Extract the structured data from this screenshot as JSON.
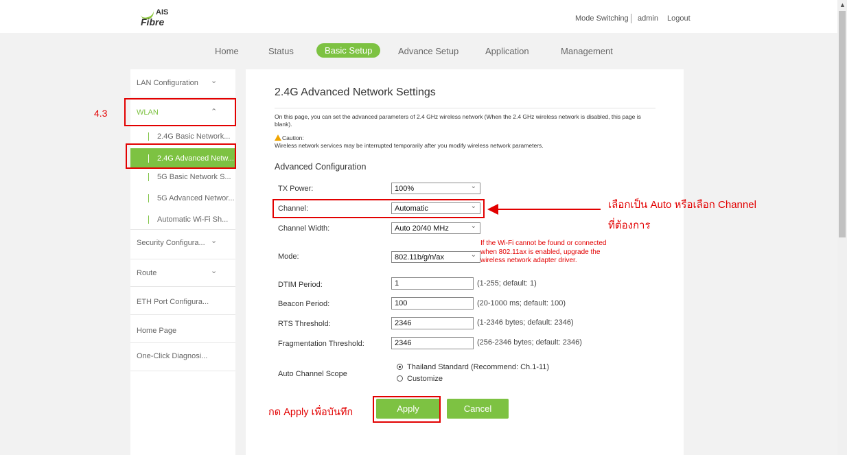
{
  "brand": {
    "logo_top": "AIS",
    "logo_bottom": "Fibre",
    "accent": "#7dc242",
    "annotation_color": "#e20000"
  },
  "header": {
    "mode_switching": "Mode Switching",
    "user": "admin",
    "logout": "Logout"
  },
  "nav": {
    "items": [
      "Home",
      "Status",
      "Basic Setup",
      "Advance Setup",
      "Application",
      "Management"
    ],
    "active": "Basic Setup"
  },
  "sidebar": {
    "items": [
      {
        "label": "LAN Configuration",
        "icon": "chevron-down-icon"
      },
      {
        "label": "WLAN",
        "icon": "chevron-up-icon"
      },
      {
        "label": "Security Configura...",
        "icon": "chevron-down-icon"
      },
      {
        "label": "Route",
        "icon": "chevron-down-icon"
      },
      {
        "label": "ETH Port Configura..."
      },
      {
        "label": "Home Page"
      },
      {
        "label": "One-Click Diagnosi..."
      }
    ],
    "wlan_sub": [
      "2.4G Basic Network...",
      "2.4G Advanced Netw...",
      "5G Basic Network S...",
      "5G Advanced Networ...",
      "Automatic Wi-Fi Sh..."
    ],
    "active_sub": "2.4G Advanced Netw..."
  },
  "page": {
    "title": "2.4G Advanced Network Settings",
    "description": "On this page, you can set the advanced parameters of 2.4 GHz wireless network (When the 2.4 GHz wireless network is disabled, this page is blank).",
    "caution_label": "Caution:",
    "caution_text": "Wireless network services may be interrupted temporarily after you modify wireless network parameters.",
    "section": "Advanced Configuration"
  },
  "form": {
    "tx_power": {
      "label": "TX Power:",
      "value": "100%"
    },
    "channel": {
      "label": "Channel:",
      "value": "Automatic"
    },
    "channel_width": {
      "label": "Channel Width:",
      "value": "Auto 20/40 MHz"
    },
    "mode": {
      "label": "Mode:",
      "value": "802.11b/g/n/ax",
      "note_lines": [
        "If the Wi-Fi cannot be found or connected",
        "when 802.11ax is enabled, upgrade the",
        "wireless network adapter driver."
      ]
    },
    "dtim": {
      "label": "DTIM Period:",
      "value": "1",
      "hint": "(1-255; default: 1)"
    },
    "beacon": {
      "label": "Beacon Period:",
      "value": "100",
      "hint": "(20-1000 ms; default: 100)"
    },
    "rts": {
      "label": "RTS Threshold:",
      "value": "2346",
      "hint": "(1-2346 bytes; default: 2346)"
    },
    "frag": {
      "label": "Fragmentation Threshold:",
      "value": "2346",
      "hint": "(256-2346 bytes; default: 2346)"
    },
    "scope": {
      "label": "Auto Channel Scope",
      "options": [
        "Thailand Standard (Recommend: Ch.1-11)",
        "Customize"
      ],
      "selected": "Thailand Standard (Recommend: Ch.1-11)"
    }
  },
  "buttons": {
    "apply": "Apply",
    "cancel": "Cancel"
  },
  "annotations": {
    "step": "4.3",
    "channel_note_line1": "เลือกเป็น Auto หรือเลือก Channel",
    "channel_note_line2": "ที่ต้องการ",
    "apply_note": "กด Apply เพื่อบันทึก"
  }
}
